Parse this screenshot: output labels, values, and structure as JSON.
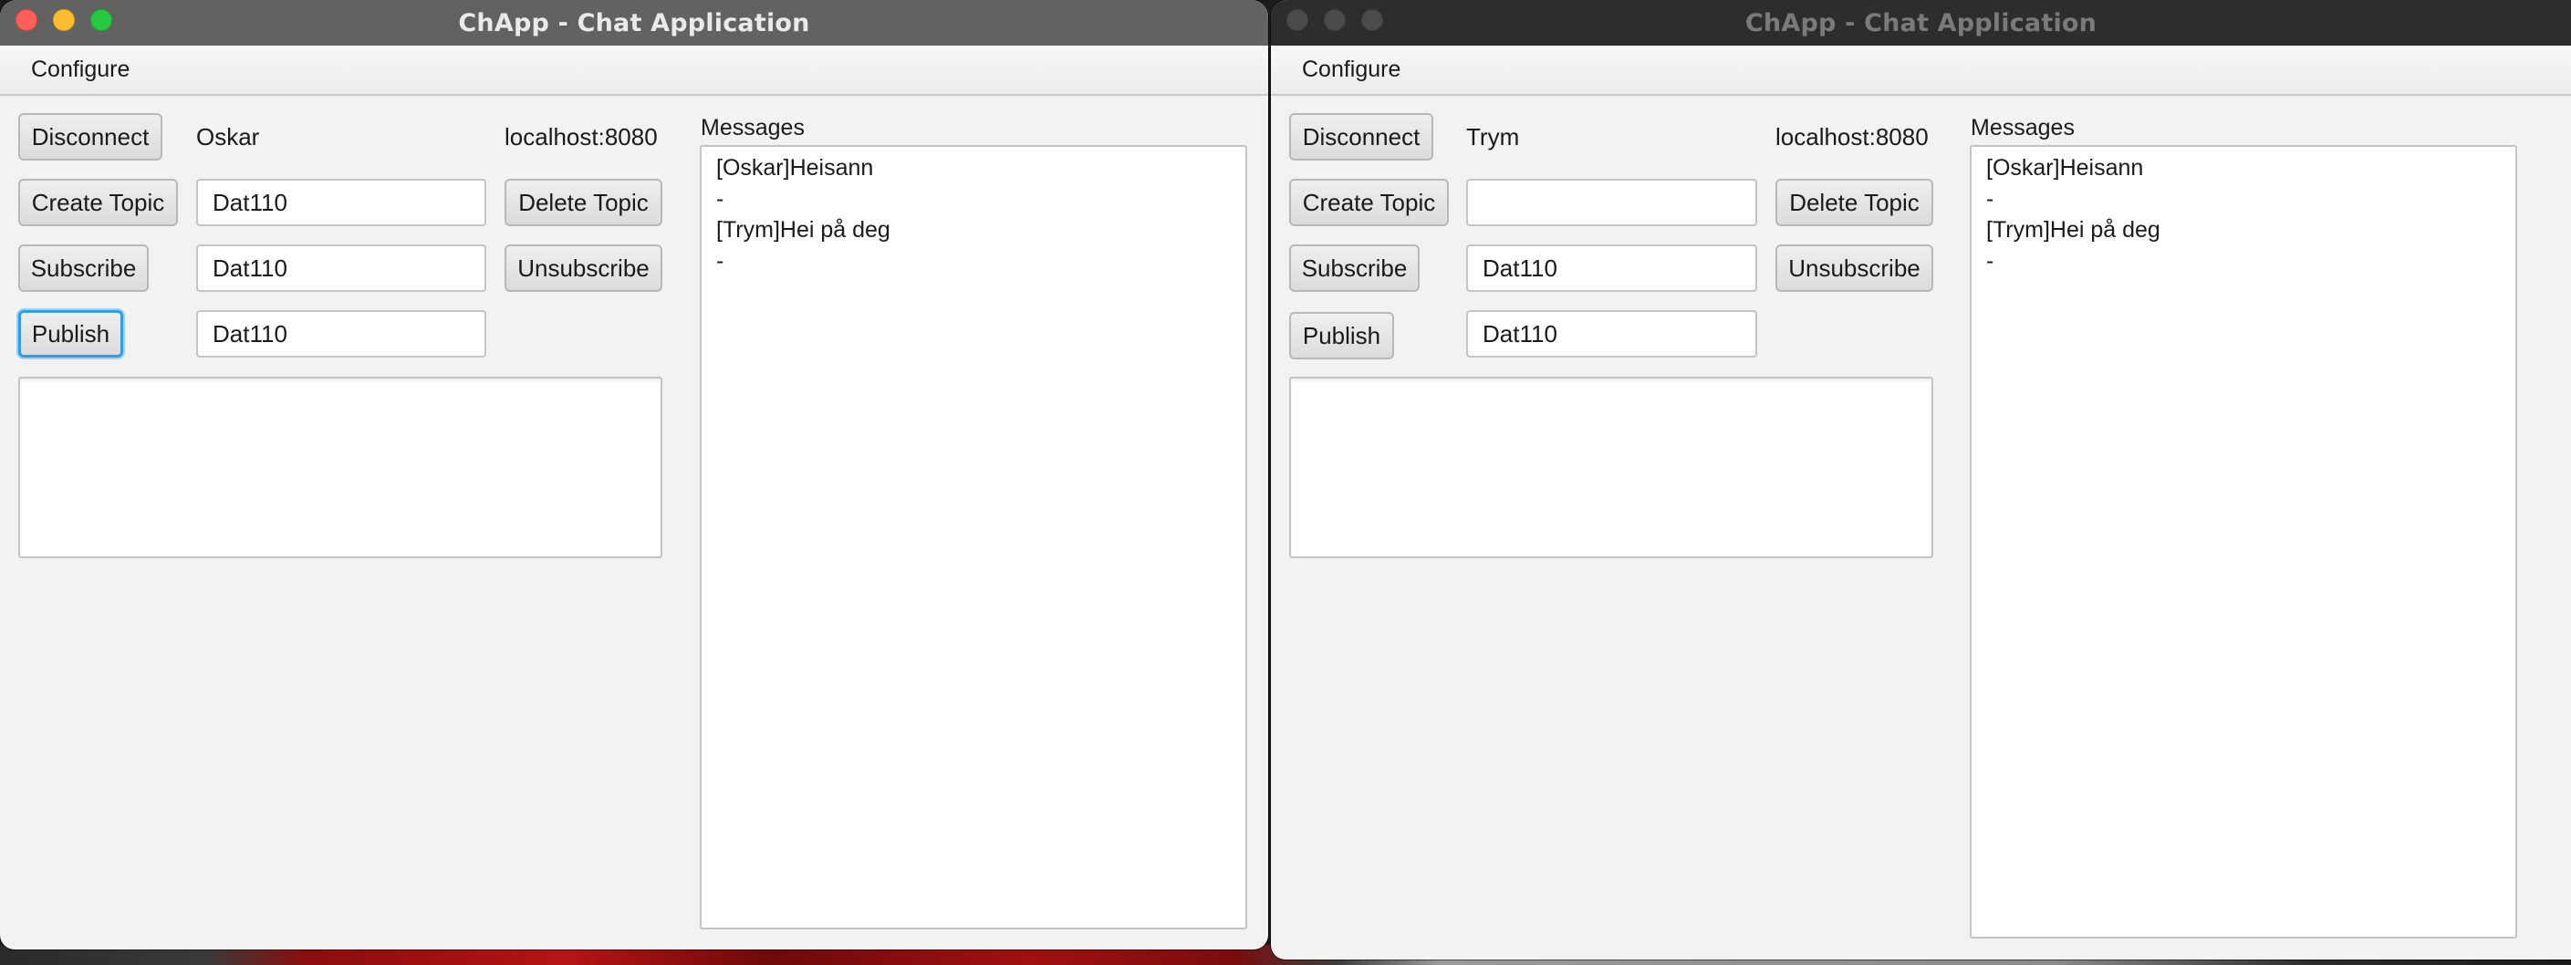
{
  "windows": [
    {
      "title": "ChApp - Chat Application",
      "menu": {
        "configure": "Configure"
      },
      "buttons": {
        "disconnect": "Disconnect",
        "create_topic": "Create Topic",
        "delete_topic": "Delete Topic",
        "subscribe": "Subscribe",
        "unsubscribe": "Unsubscribe",
        "publish": "Publish"
      },
      "user": "Oskar",
      "server": "localhost:8080",
      "fields": {
        "create_topic": "Dat110",
        "subscribe": "Dat110",
        "publish": "Dat110",
        "message_text": ""
      },
      "messages_label": "Messages",
      "messages": [
        "[Oskar]Heisann",
        "-",
        "[Trym]Hei på deg",
        "-"
      ],
      "active": true,
      "focused_button": "publish"
    },
    {
      "title": "ChApp - Chat Application",
      "menu": {
        "configure": "Configure"
      },
      "buttons": {
        "disconnect": "Disconnect",
        "create_topic": "Create Topic",
        "delete_topic": "Delete Topic",
        "subscribe": "Subscribe",
        "unsubscribe": "Unsubscribe",
        "publish": "Publish"
      },
      "user": "Trym",
      "server": "localhost:8080",
      "fields": {
        "create_topic": "",
        "subscribe": "Dat110",
        "publish": "Dat110",
        "message_text": ""
      },
      "messages_label": "Messages",
      "messages": [
        "[Oskar]Heisann",
        "-",
        "[Trym]Hei på deg",
        "-"
      ],
      "active": false
    }
  ],
  "colors": {
    "close": "#fe5f57",
    "minimize": "#febc2e",
    "maximize": "#28c840",
    "focus_ring": "#2f9ee6",
    "window_bg": "#f2f2f2"
  }
}
